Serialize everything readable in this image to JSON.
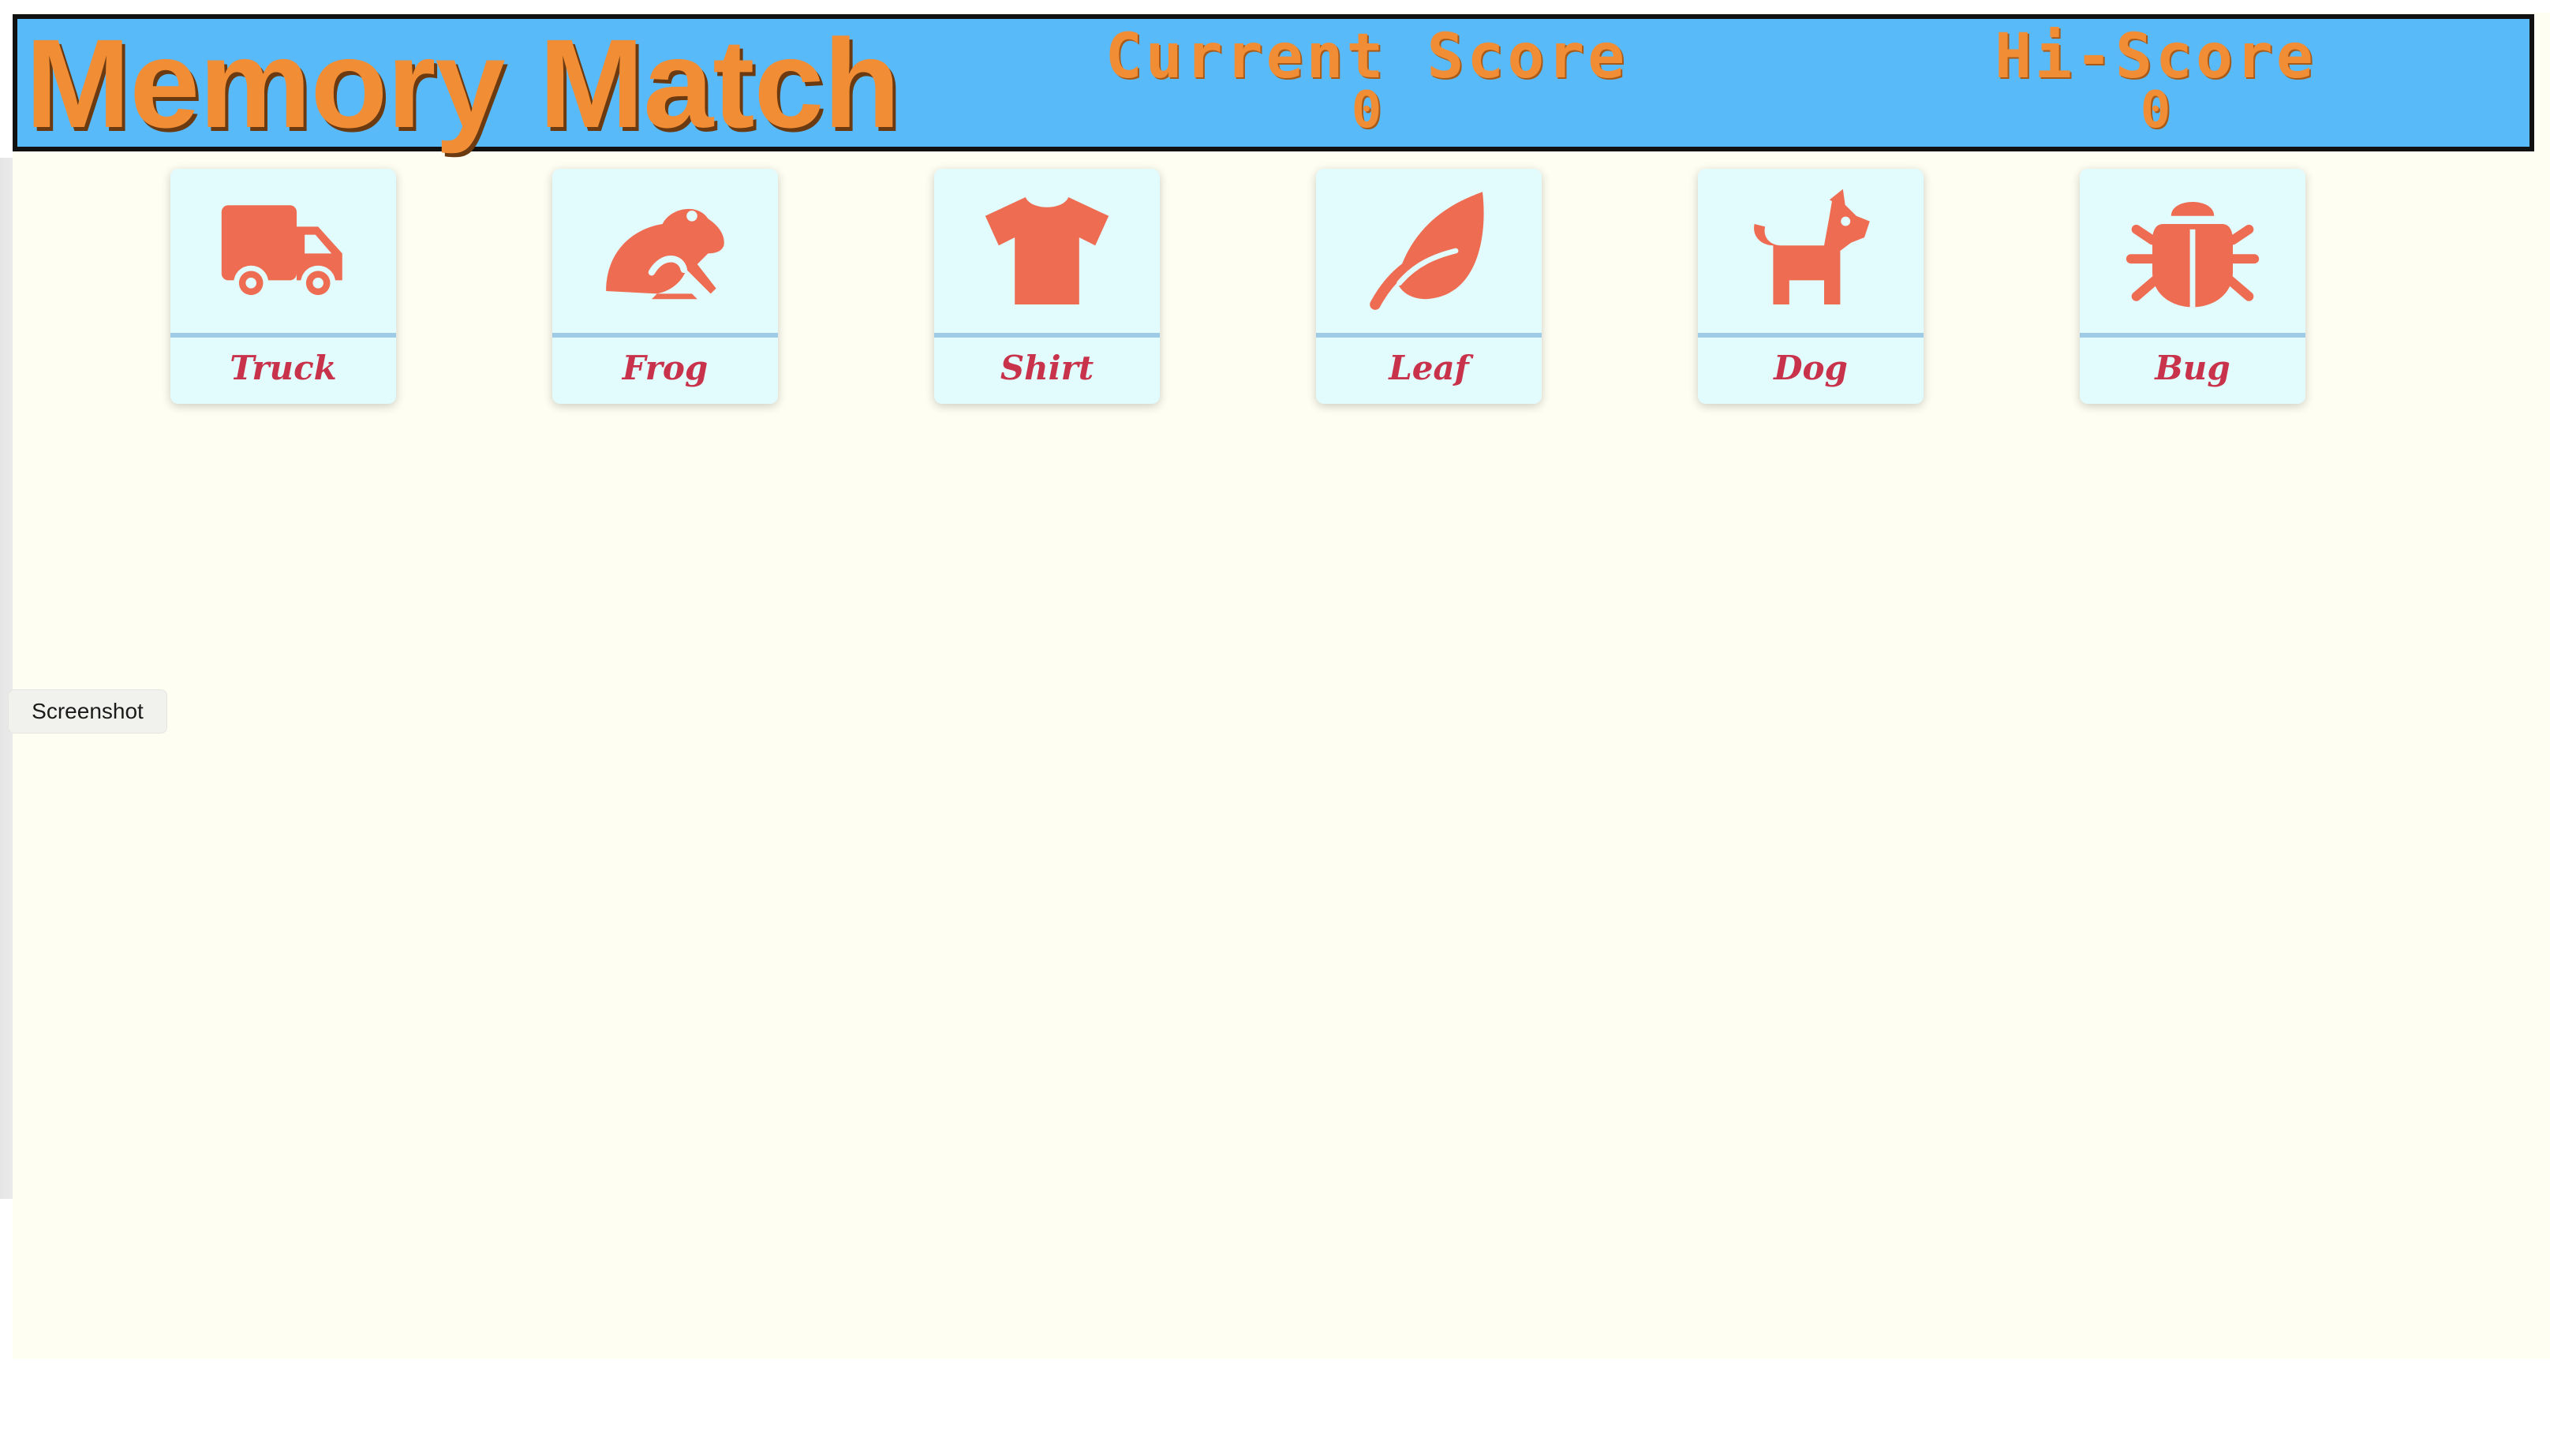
{
  "header": {
    "title": "Memory Match",
    "current_score": {
      "label": "Current Score",
      "value": "0"
    },
    "hi_score": {
      "label": "Hi-Score",
      "value": "0"
    }
  },
  "cards": [
    {
      "label": "Truck",
      "icon": "truck-icon"
    },
    {
      "label": "Frog",
      "icon": "frog-icon"
    },
    {
      "label": "Shirt",
      "icon": "shirt-icon"
    },
    {
      "label": "Leaf",
      "icon": "leaf-icon"
    },
    {
      "label": "Dog",
      "icon": "dog-icon"
    },
    {
      "label": "Bug",
      "icon": "bug-icon"
    }
  ],
  "screenshot_button": {
    "label": "Screenshot"
  },
  "colors": {
    "header_bg": "#58baf9",
    "title": "#f08d35",
    "icon": "#ee6d52",
    "card_bg": "#e2fbfd",
    "card_label": "#c8324a",
    "page_bg": "#fefef2"
  }
}
